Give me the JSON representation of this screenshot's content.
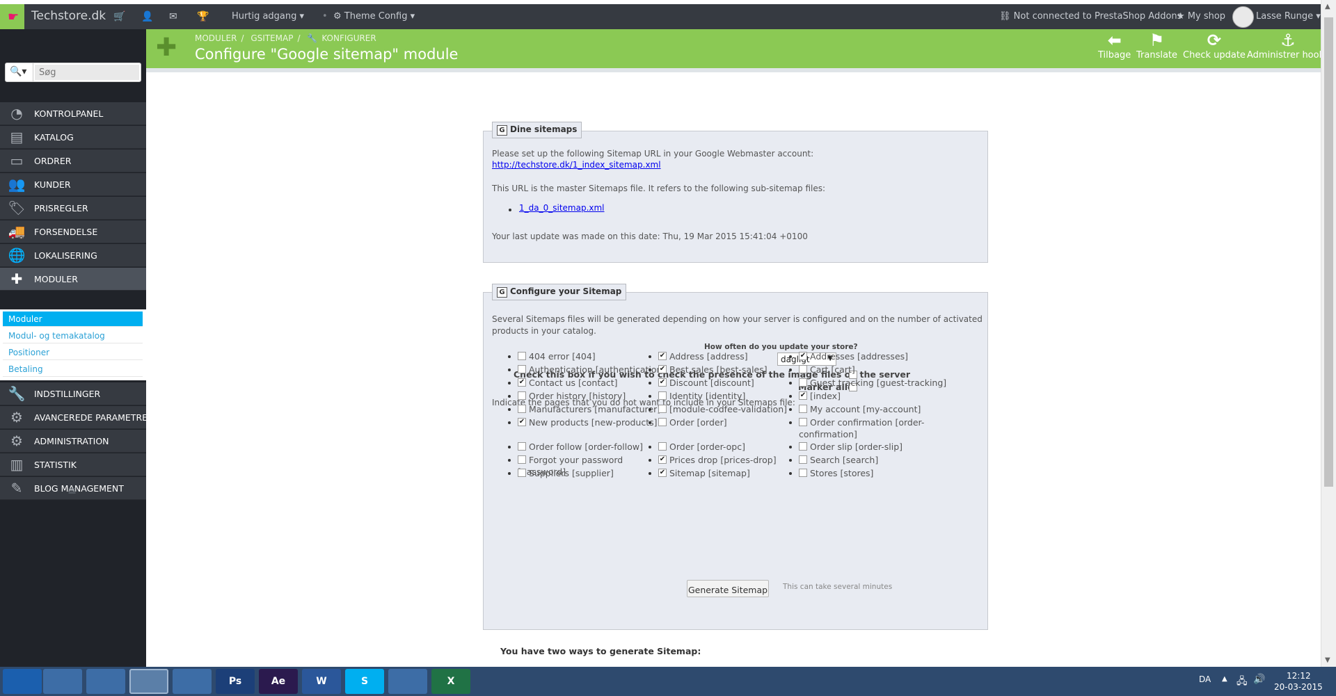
{
  "topbar": {
    "brand": "Techstore.dk",
    "quick_access": "Hurtig adgang",
    "theme_config": "Theme Config",
    "addons_status": "Not connected to PrestaShop Addons",
    "my_shop": "My shop",
    "user": "Lasse Runge"
  },
  "header": {
    "breadcrumb": [
      "MODULER",
      "GSITEMAP",
      "KONFIGURER"
    ],
    "title": "Configure \"Google sitemap\" module",
    "toolbar": [
      {
        "label": "Tilbage",
        "icon": "back-arrow-icon"
      },
      {
        "label": "Translate",
        "icon": "flag-icon"
      },
      {
        "label": "Check update",
        "icon": "refresh-icon"
      },
      {
        "label": "Administrer hooks",
        "icon": "anchor-icon"
      }
    ]
  },
  "sidebar": {
    "search_placeholder": "Søg",
    "items": [
      {
        "label": "KONTROLPANEL",
        "icon": "dashboard-icon"
      },
      {
        "label": "KATALOG",
        "icon": "catalog-icon"
      },
      {
        "label": "ORDRER",
        "icon": "credit-card-icon"
      },
      {
        "label": "KUNDER",
        "icon": "users-icon"
      },
      {
        "label": "PRISREGLER",
        "icon": "tags-icon"
      },
      {
        "label": "FORSENDELSE",
        "icon": "truck-icon"
      },
      {
        "label": "LOKALISERING",
        "icon": "globe-icon"
      },
      {
        "label": "MODULER",
        "icon": "puzzle-icon"
      },
      {
        "label": "INDSTILLINGER",
        "icon": "wrench-icon"
      },
      {
        "label": "AVANCEREDE PARAMETRE",
        "icon": "cogs-icon"
      },
      {
        "label": "ADMINISTRATION",
        "icon": "cog-icon"
      },
      {
        "label": "STATISTIK",
        "icon": "bar-chart-icon"
      },
      {
        "label": "BLOG MANAGEMENT",
        "icon": "pencil-icon"
      }
    ],
    "submenu": [
      "Moduler",
      "Modul- og temakatalog",
      "Positioner",
      "Betaling"
    ]
  },
  "sitemaps_panel": {
    "legend": "Dine sitemaps",
    "intro": "Please set up the following Sitemap URL in your Google Webmaster account:",
    "master_url": "http://techstore.dk/1_index_sitemap.xml",
    "sub_intro": "This URL is the master Sitemaps file. It refers to the following sub-sitemap files:",
    "sub_files": [
      "1_da_0_sitemap.xml"
    ],
    "last_update": "Your last update was made on this date: Thu, 19 Mar 2015 15:41:04 +0100"
  },
  "config_panel": {
    "legend": "Configure your Sitemap",
    "desc_line1": "Several Sitemaps files will be generated depending on how your server is configured and on the number of activated",
    "desc_line2": "products in your catalog.",
    "frequency_label": "How often do you update your store?",
    "frequency_value": "dagligt",
    "image_check_label": "Check this box if you wish to check the presence of the image files on the server",
    "image_check_checked": false,
    "select_all_label": "Marker alle",
    "select_all_checked": false,
    "pages_intro": "Indicate the pages that you do not want to include in your Sitemaps file:",
    "columns": [
      [
        {
          "label": "404 error [404]",
          "checked": false
        },
        {
          "label": "Authentication [authentication]",
          "checked": false
        },
        {
          "label": "Contact us [contact]",
          "checked": true
        },
        {
          "label": "Order history [history]",
          "checked": false
        },
        {
          "label": "Manufacturers [manufacturer]",
          "checked": false
        },
        {
          "label": "New products [new-products]",
          "checked": true
        },
        {
          "label": "Order follow [order-follow]",
          "checked": false
        },
        {
          "label": "Forgot your password",
          "label2": "[password]",
          "checked": false
        },
        {
          "label": "Suppliers [supplier]",
          "checked": false
        }
      ],
      [
        {
          "label": "Address [address]",
          "checked": true
        },
        {
          "label": "Best sales [best-sales]",
          "checked": true
        },
        {
          "label": "Discount [discount]",
          "checked": true
        },
        {
          "label": "Identity [identity]",
          "checked": false
        },
        {
          "label": "[module-codfee-validation]",
          "checked": false
        },
        {
          "label": "Order [order]",
          "checked": false
        },
        {
          "label": "Order [order-opc]",
          "checked": false
        },
        {
          "label": "Prices drop [prices-drop]",
          "checked": true
        },
        {
          "label": "Sitemap [sitemap]",
          "checked": true
        }
      ],
      [
        {
          "label": "Addresses [addresses]",
          "checked": true
        },
        {
          "label": "Cart [cart]",
          "checked": false
        },
        {
          "label": "Guest tracking [guest-tracking]",
          "checked": false
        },
        {
          "label": "[index]",
          "checked": true
        },
        {
          "label": "My account [my-account]",
          "checked": false
        },
        {
          "label": "Order confirmation [order-",
          "label2": "confirmation]",
          "checked": false
        },
        {
          "label": "Order slip [order-slip]",
          "checked": false
        },
        {
          "label": "Search [search]",
          "checked": false
        },
        {
          "label": "Stores [stores]",
          "checked": false
        }
      ]
    ],
    "generate_button": "Generate Sitemap",
    "generate_hint": "This can take several minutes"
  },
  "footer_heading": "You have two ways to generate Sitemap:",
  "taskbar": {
    "language": "DA",
    "time": "12:12",
    "date": "20-03-2015",
    "apps": [
      "windows-start-icon",
      "file-explorer-icon",
      "media-player-icon",
      "chrome-icon",
      "outlook-icon",
      "photoshop-icon",
      "after-effects-icon",
      "word-icon",
      "skype-icon",
      "folder-icon",
      "excel-icon"
    ],
    "app_labels": [
      "",
      "",
      "",
      "",
      "",
      "Ps",
      "Ae",
      "W",
      "S",
      "",
      "X"
    ]
  }
}
